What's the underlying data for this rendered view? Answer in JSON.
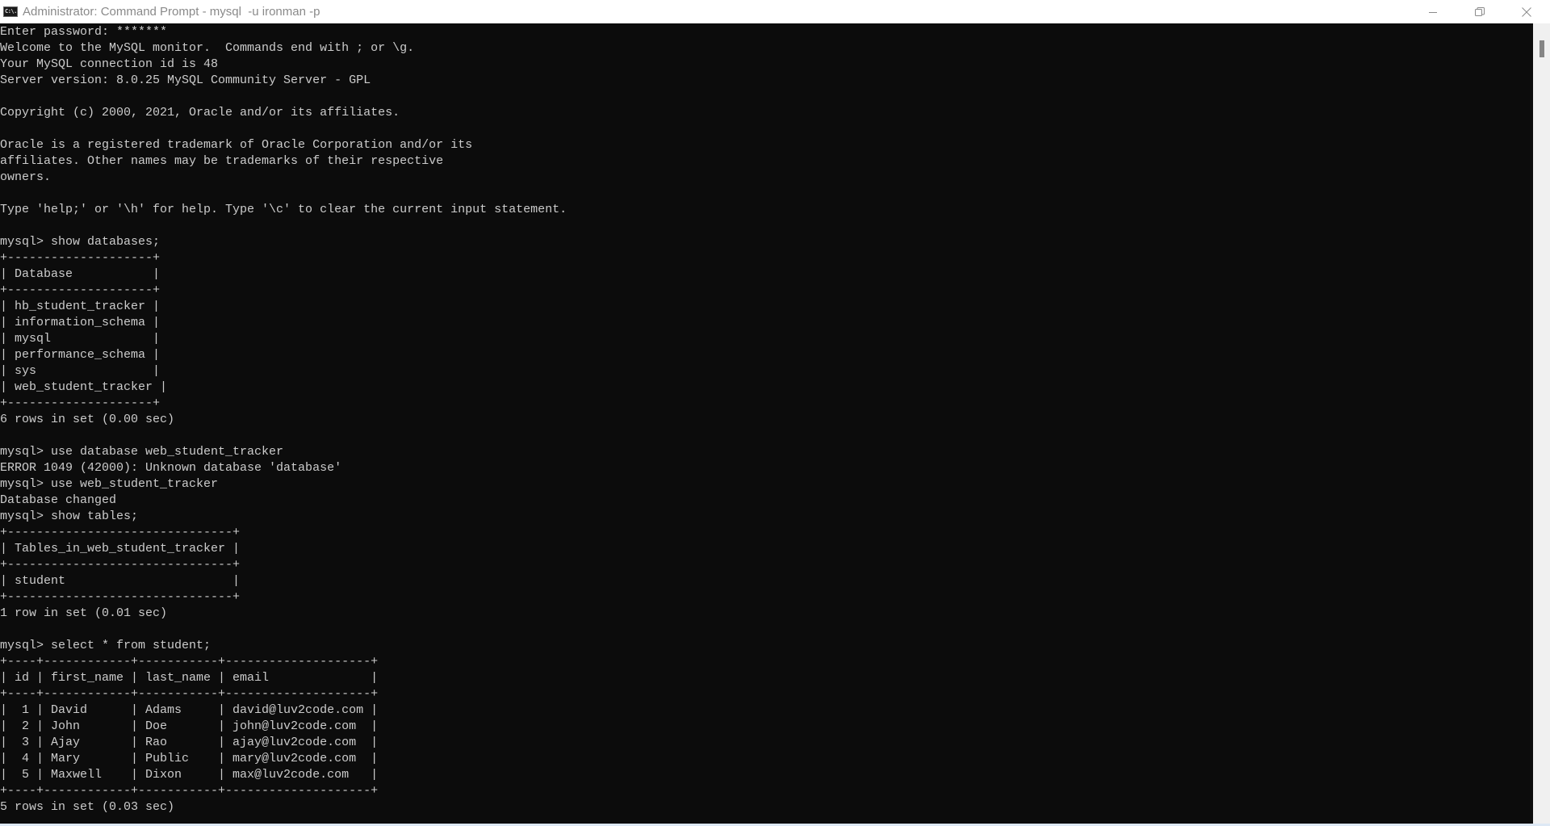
{
  "window": {
    "title": "Administrator: Command Prompt - mysql  -u ironman -p",
    "app_icon_glyph": "C:\\.",
    "controls": {
      "minimize": "minimize-icon",
      "restore": "restore-icon",
      "close": "close-icon"
    }
  },
  "console": {
    "text_color": "#cccccc",
    "background": "#0c0c0c",
    "lines": [
      "Enter password: *******",
      "Welcome to the MySQL monitor.  Commands end with ; or \\g.",
      "Your MySQL connection id is 48",
      "Server version: 8.0.25 MySQL Community Server - GPL",
      "",
      "Copyright (c) 2000, 2021, Oracle and/or its affiliates.",
      "",
      "Oracle is a registered trademark of Oracle Corporation and/or its",
      "affiliates. Other names may be trademarks of their respective",
      "owners.",
      "",
      "Type 'help;' or '\\h' for help. Type '\\c' to clear the current input statement.",
      "",
      "mysql> show databases;",
      "+--------------------+",
      "| Database           |",
      "+--------------------+",
      "| hb_student_tracker |",
      "| information_schema |",
      "| mysql              |",
      "| performance_schema |",
      "| sys                |",
      "| web_student_tracker |",
      "+--------------------+",
      "6 rows in set (0.00 sec)",
      "",
      "mysql> use database web_student_tracker",
      "ERROR 1049 (42000): Unknown database 'database'",
      "mysql> use web_student_tracker",
      "Database changed",
      "mysql> show tables;",
      "+-------------------------------+",
      "| Tables_in_web_student_tracker |",
      "+-------------------------------+",
      "| student                       |",
      "+-------------------------------+",
      "1 row in set (0.01 sec)",
      "",
      "mysql> select * from student;",
      "+----+------------+-----------+--------------------+",
      "| id | first_name | last_name | email              |",
      "+----+------------+-----------+--------------------+",
      "|  1 | David      | Adams     | david@luv2code.com |",
      "|  2 | John       | Doe       | john@luv2code.com  |",
      "|  3 | Ajay       | Rao       | ajay@luv2code.com  |",
      "|  4 | Mary       | Public    | mary@luv2code.com  |",
      "|  5 | Maxwell    | Dixon     | max@luv2code.com   |",
      "+----+------------+-----------+--------------------+",
      "5 rows in set (0.03 sec)"
    ]
  },
  "scrollbar": {
    "position_fraction": 0.02
  }
}
